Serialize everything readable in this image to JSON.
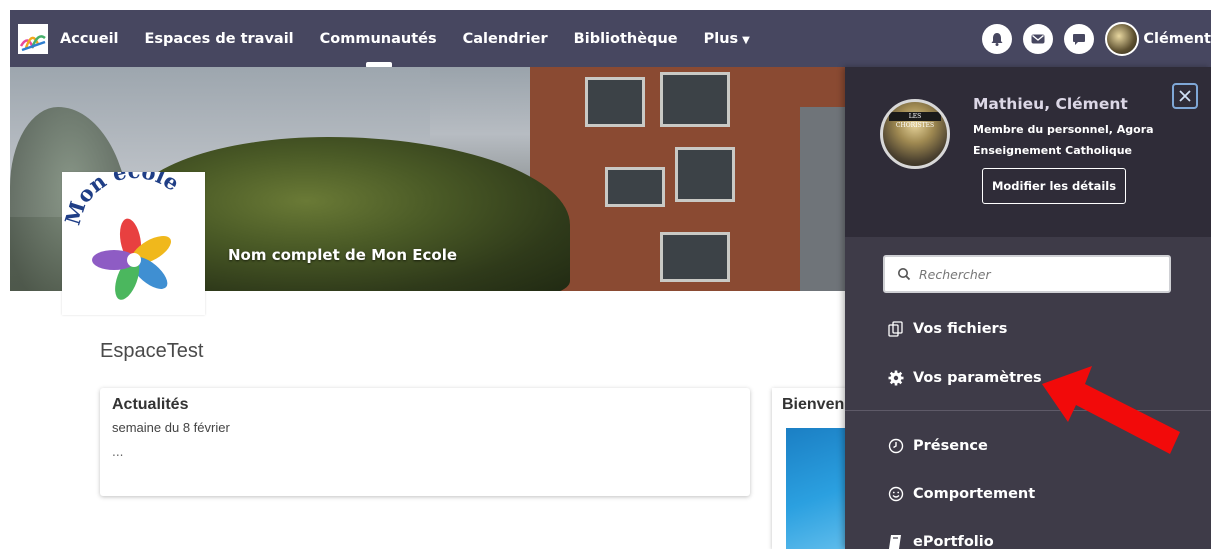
{
  "nav": {
    "items": [
      {
        "label": "Accueil"
      },
      {
        "label": "Espaces de travail"
      },
      {
        "label": "Communautés"
      },
      {
        "label": "Calendrier"
      },
      {
        "label": "Bibliothèque"
      },
      {
        "label": "Plus"
      }
    ],
    "active": "Communautés",
    "user_label": "Clément",
    "icons": [
      "bell-icon",
      "mail-icon",
      "chat-icon"
    ]
  },
  "banner": {
    "title": "Nom complet de Mon Ecole"
  },
  "school_logo": {
    "text": "Mon école"
  },
  "space": {
    "title": "EspaceTest"
  },
  "news": {
    "title": "Actualités",
    "subtitle": "semaine du 8 février",
    "body": "..."
  },
  "welcome": {
    "title": "Bienvenue"
  },
  "panel": {
    "name": "Mathieu, Clément",
    "role": "Membre du personnel, Agora Enseignement Catholique",
    "avatar_caption": "LES CHORISTES",
    "edit_label": "Modifier les détails",
    "search_placeholder": "Rechercher",
    "menu": [
      {
        "label": "Vos fichiers",
        "icon": "files-icon"
      },
      {
        "label": "Vos paramètres",
        "icon": "gear-icon"
      },
      {
        "label": "Présence",
        "icon": "clock-icon"
      },
      {
        "label": "Comportement",
        "icon": "smiley-icon"
      },
      {
        "label": "ePortfolio",
        "icon": "book-icon"
      }
    ]
  },
  "colors": {
    "nav_bg": "#474760",
    "panel_bg": "#3e3b48",
    "panel_head_bg": "#2f2c38",
    "annotation_arrow": "#f20a0a"
  }
}
